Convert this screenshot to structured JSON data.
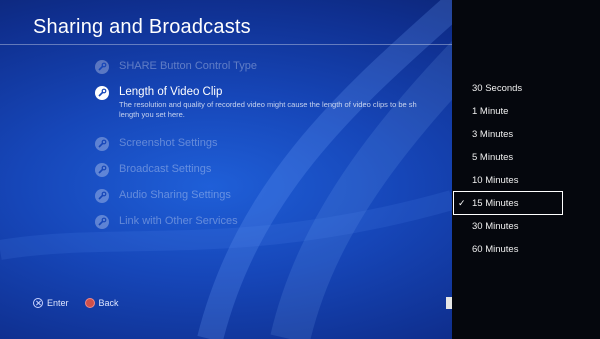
{
  "header": {
    "title": "Sharing and Broadcasts"
  },
  "menu": {
    "items": [
      {
        "label": "SHARE Button Control Type"
      },
      {
        "label": "Length of Video Clip",
        "description_line1": "The resolution and quality of recorded video might cause the length of video clips to be sh",
        "description_line2": "length you set here."
      },
      {
        "label": "Screenshot Settings"
      },
      {
        "label": "Broadcast Settings"
      },
      {
        "label": "Audio Sharing Settings"
      },
      {
        "label": "Link with Other Services"
      }
    ]
  },
  "dropdown": {
    "options": [
      "30 Seconds",
      "1 Minute",
      "3 Minutes",
      "5 Minutes",
      "10 Minutes",
      "15 Minutes",
      "30 Minutes",
      "60 Minutes"
    ],
    "selected": "15 Minutes",
    "check_glyph": "✓"
  },
  "footer": {
    "enter_label": "Enter",
    "back_label": "Back"
  },
  "colors": {
    "background": "#1646b8",
    "panel": "#05070d",
    "back_button": "#d0504a"
  },
  "icons": {
    "menu_icon": "wrench-icon",
    "enter_icon": "cross-button-icon",
    "back_icon": "circle-button-icon"
  }
}
